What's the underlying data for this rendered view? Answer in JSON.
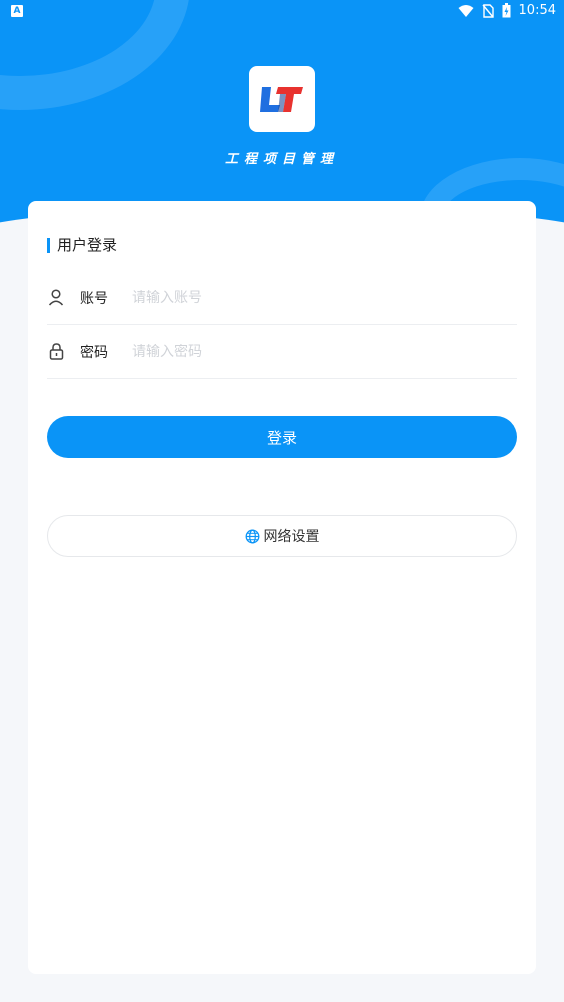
{
  "status_bar": {
    "notification_icon": "A",
    "time": "10:54"
  },
  "app": {
    "name": "工程项目管理",
    "logo_text": "LT"
  },
  "login": {
    "title": "用户登录",
    "account_label": "账号",
    "account_placeholder": "请输入账号",
    "password_label": "密码",
    "password_placeholder": "请输入密码",
    "submit_label": "登录"
  },
  "network": {
    "label": "网络设置"
  },
  "colors": {
    "primary": "#0a94f7",
    "background": "#f5f7fa",
    "card": "#ffffff"
  }
}
